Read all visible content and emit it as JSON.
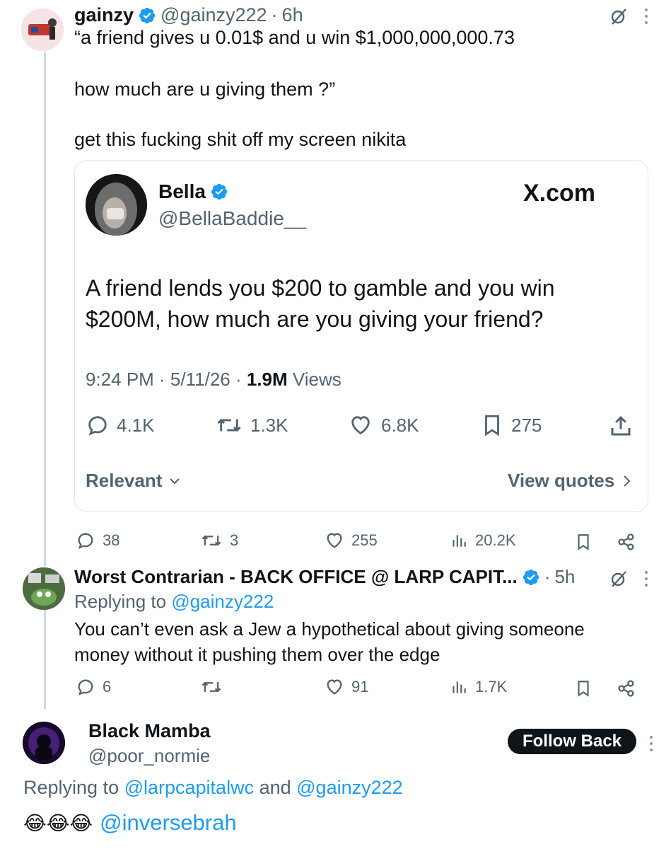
{
  "main_tweet": {
    "name": "gainzy",
    "handle": "@gainzy222",
    "time": "6h",
    "text_lines": [
      "“a friend gives u 0.01$ and u win $1,000,000,000.73",
      "how much are u giving them ?”",
      "get this fucking shit off my screen nikita"
    ],
    "stats": {
      "replies": "38",
      "reposts": "3",
      "likes": "255",
      "views": "20.2K"
    }
  },
  "quoted": {
    "name": "Bella",
    "handle": "@BellaBaddie__",
    "brand": "X.com",
    "text_lines": [
      "A friend lends you $200 to gamble and you win",
      "$200M, how much are you giving your friend?"
    ],
    "timestamp": "9:24 PM · 5/11/26 · ",
    "views_count": "1.9M",
    "views_label": " Views",
    "stats": {
      "replies": "4.1K",
      "reposts": "1.3K",
      "likes": "6.8K",
      "bookmarks": "275"
    },
    "sort_label": "Relevant",
    "view_quotes_label": "View quotes"
  },
  "reply1": {
    "name": "Worst Contrarian - BACK OFFICE @ LARP CAPIT...",
    "time": "5h",
    "replying_prefix": "Replying to ",
    "replying_to": "@gainzy222",
    "text_lines": [
      "You can’t even ask a Jew a hypothetical about giving someone",
      "money without it pushing them over the edge"
    ],
    "stats": {
      "replies": "6",
      "reposts": "",
      "likes": "91",
      "views": "1.7K"
    }
  },
  "reply2": {
    "name": "Black Mamba",
    "handle": "@poor_normie",
    "follow_label": "Follow Back",
    "replying_prefix": "Replying to ",
    "replying_to_1": "@larpcapitalwc",
    "replying_and": " and ",
    "replying_to_2": "@gainzy222",
    "emojis": "😂😂😂",
    "mention": "@inversebrah"
  },
  "colors": {
    "link_blue": "#1d9bf0",
    "text": "#0f1419",
    "muted": "#536471",
    "divider": "#cfd9de",
    "button_dark": "#0f1419"
  },
  "icons": [
    "verified-icon",
    "grok-icon",
    "more-icon",
    "reply-icon",
    "repost-icon",
    "like-icon",
    "bookmark-icon",
    "views-icon",
    "share-icon",
    "chevron-down-icon",
    "chevron-right-icon"
  ]
}
